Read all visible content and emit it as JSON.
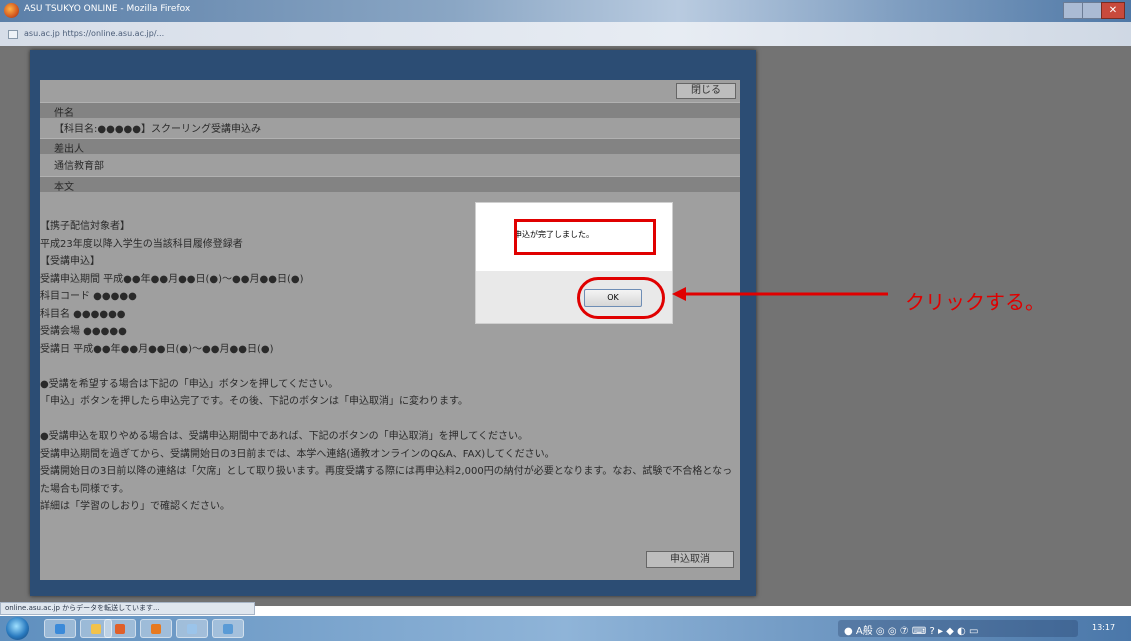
{
  "browser": {
    "window_title": "ASU TSUKYO ONLINE - Mozilla Firefox",
    "url": "asu.ac.jp  https://online.asu.ac.jp/...",
    "status_text": "online.asu.ac.jp からデータを転送しています..."
  },
  "popup": {
    "close_label": "閉じる",
    "subject_header": "件名",
    "subject_value": "【科目名:●●●●●】スクーリング受講申込み",
    "sender_header": "差出人",
    "sender_value": "通信教育部",
    "body_header": "本文",
    "body_lines": [
      "【携子配信対象者】",
      "平成23年度以降入学生の当該科目履修登録者",
      "【受講申込】",
      "受講申込期間  平成●●年●●月●●日(●)～●●月●●日(●)",
      "科目コード  ●●●●●",
      "科目名  ●●●●●●",
      "受講会場  ●●●●●",
      "受講日  平成●●年●●月●●日(●)～●●月●●日(●)",
      "",
      "●受講を希望する場合は下記の「申込」ボタンを押してください。",
      "「申込」ボタンを押したら申込完了です。その後、下記のボタンは「申込取消」に変わります。",
      "",
      "●受講申込を取りやめる場合は、受講申込期間中であれば、下記のボタンの「申込取消」を押してください。",
      "受講申込期間を過ぎてから、受講開始日の3日前までは、本学へ連絡(通教オンラインのQ&A、FAX)してください。",
      "受講開始日の3日前以降の連絡は「欠席」として取り扱います。再度受講する際には再申込料2,000円の納付が必要となります。なお、試験で不合格となった場合も同様です。",
      "詳細は「学習のしおり」で確認ください。"
    ],
    "cancel_label": "申込取消"
  },
  "dialog": {
    "message": "申込が完了しました。",
    "ok_label": "OK"
  },
  "annotation": {
    "instruction": "クリックする。",
    "color": "#e00000"
  },
  "taskbar": {
    "clock": "13:17",
    "tray_icons": "● A般 ◎ ◎ ⑦ ⌨ ? ▸ ◆ ◐ ▭"
  }
}
